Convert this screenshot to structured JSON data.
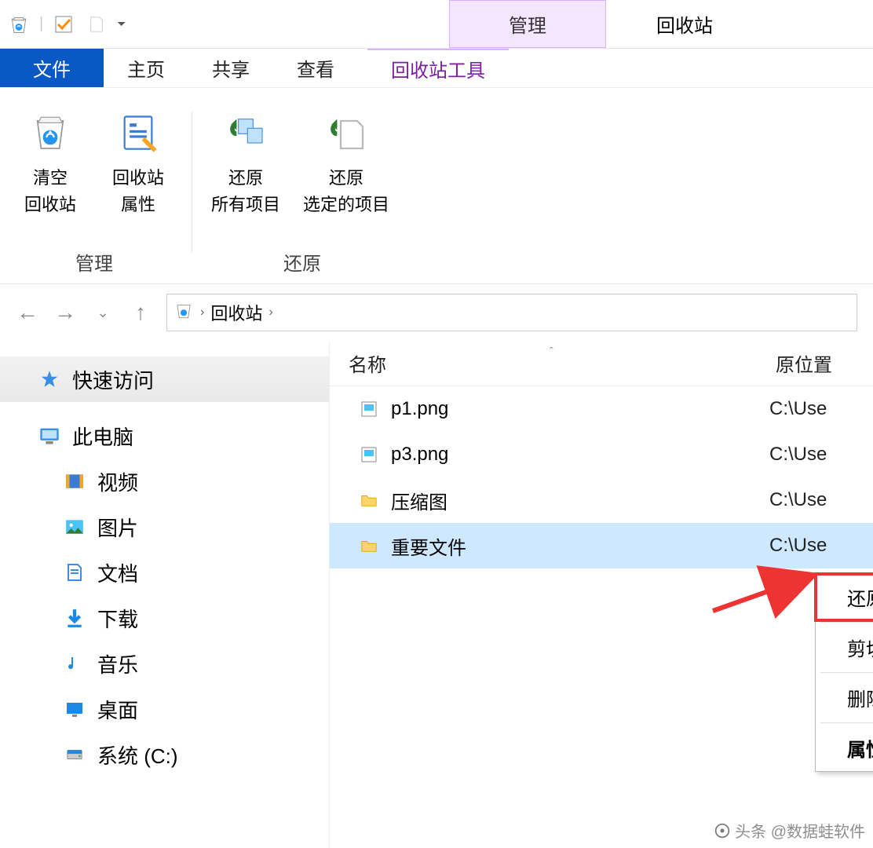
{
  "title_bar": {
    "manage_label": "管理",
    "window_title": "回收站"
  },
  "tabs": {
    "file": "文件",
    "home": "主页",
    "share": "共享",
    "view": "查看",
    "recycle_tools": "回收站工具"
  },
  "ribbon": {
    "group_manage": {
      "label": "管理",
      "empty_line1": "清空",
      "empty_line2": "回收站",
      "props_line1": "回收站",
      "props_line2": "属性"
    },
    "group_restore": {
      "label": "还原",
      "restore_all_line1": "还原",
      "restore_all_line2": "所有项目",
      "restore_sel_line1": "还原",
      "restore_sel_line2": "选定的项目"
    }
  },
  "breadcrumb": {
    "location": "回收站"
  },
  "sidebar": {
    "quick_access": "快速访问",
    "this_pc": "此电脑",
    "video": "视频",
    "pictures": "图片",
    "documents": "文档",
    "downloads": "下载",
    "music": "音乐",
    "desktop": "桌面",
    "system_c": "系统 (C:)"
  },
  "columns": {
    "name": "名称",
    "original_location": "原位置"
  },
  "files": [
    {
      "name": "p1.png",
      "type": "image",
      "location": "C:\\Use"
    },
    {
      "name": "p3.png",
      "type": "image",
      "location": "C:\\Use"
    },
    {
      "name": "压缩图",
      "type": "folder",
      "location": "C:\\Use"
    },
    {
      "name": "重要文件",
      "type": "folder",
      "location": "C:\\Use",
      "selected": true
    }
  ],
  "context_menu": {
    "restore": "还原(E)",
    "cut": "剪切(T)",
    "delete": "删除(D)",
    "properties": "属性(R)"
  },
  "watermark": "头条 @数据蛙软件"
}
